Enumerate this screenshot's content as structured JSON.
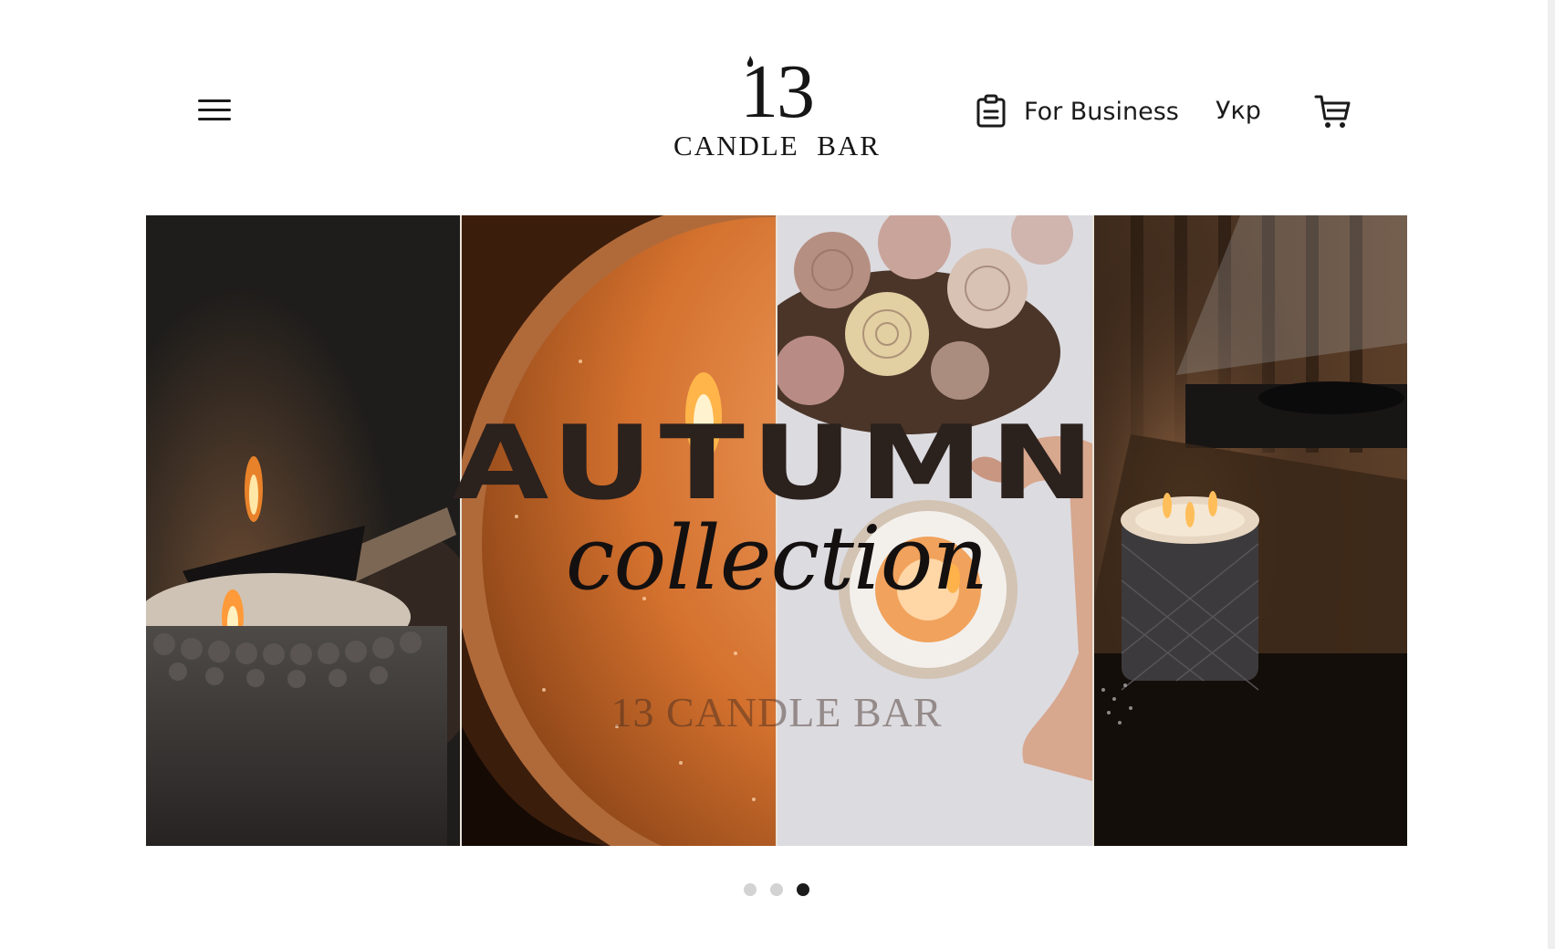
{
  "header": {
    "logo": {
      "number": "13",
      "name": "CANDLE  BAR"
    },
    "nav": {
      "business_label": "For Business",
      "language_label": "Укр"
    },
    "icons": {
      "menu": "hamburger-menu-icon",
      "business": "clipboard-icon",
      "cart": "shopping-cart-icon"
    }
  },
  "hero": {
    "title": "AUTUMN",
    "script": "collection",
    "brand": "13 CANDLE BAR",
    "panels": [
      "candle-lit-with-wood-stick",
      "orange-candle-close-up",
      "roses-and-candle-in-hand",
      "triple-wick-candle-by-turntable"
    ]
  },
  "carousel": {
    "slide_count": 3,
    "active_index": 2
  },
  "colors": {
    "text": "#1b1b1b",
    "dot_inactive": "#d3d3d3",
    "dot_active": "#1b1b1b",
    "accent_orange": "#c86a2c"
  }
}
